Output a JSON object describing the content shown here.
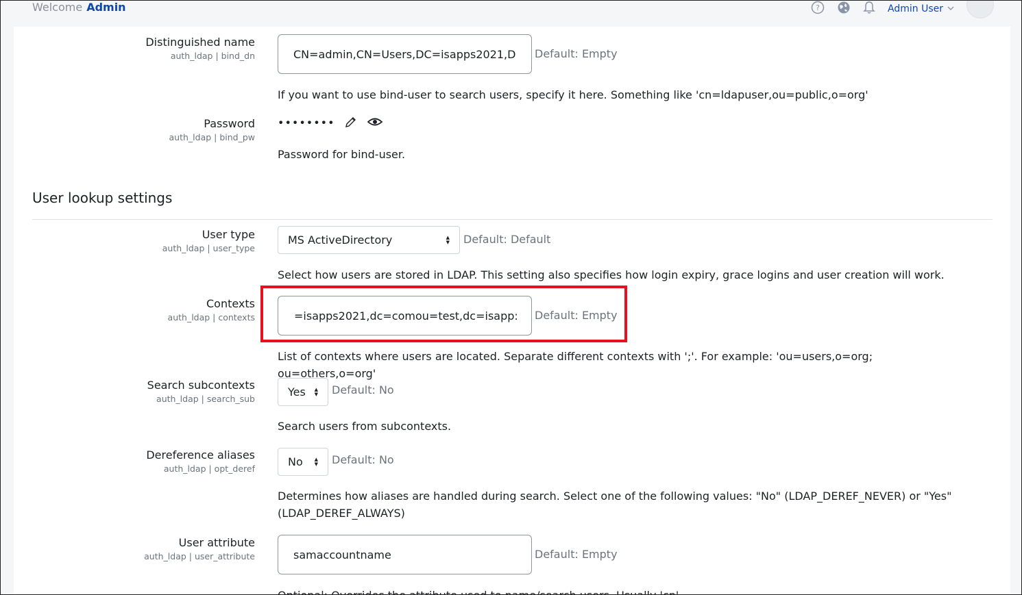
{
  "header": {
    "welcome_text": "Welcome",
    "welcome_name": "Admin",
    "user_menu_label": "Admin User"
  },
  "settings": {
    "bind_dn": {
      "label": "Distinguished name",
      "key": "auth_ldap | bind_dn",
      "value": "CN=admin,CN=Users,DC=isapps2021,D",
      "default": "Default: Empty",
      "description": "If you want to use bind-user to search users, specify it here. Something like 'cn=ldapuser,ou=public,o=org'"
    },
    "bind_pw": {
      "label": "Password",
      "key": "auth_ldap | bind_pw",
      "value": "••••••••",
      "description": "Password for bind-user."
    },
    "section_title": "User lookup settings",
    "user_type": {
      "label": "User type",
      "key": "auth_ldap | user_type",
      "value": "MS ActiveDirectory",
      "default": "Default: Default",
      "description": "Select how users are stored in LDAP. This setting also specifies how login expiry, grace logins and user creation will work."
    },
    "contexts": {
      "label": "Contexts",
      "key": "auth_ldap | contexts",
      "value_before_caret": "=isapps2021,dc=com",
      "value_after_caret": "ou=test,dc=isapp:",
      "default": "Default: Empty",
      "description": "List of contexts where users are located. Separate different contexts with ';'. For example: 'ou=users,o=org; ou=others,o=org'"
    },
    "search_sub": {
      "label": "Search subcontexts",
      "key": "auth_ldap | search_sub",
      "value": "Yes",
      "default": "Default: No",
      "description": "Search users from subcontexts."
    },
    "opt_deref": {
      "label": "Dereference aliases",
      "key": "auth_ldap | opt_deref",
      "value": "No",
      "default": "Default: No",
      "description": "Determines how aliases are handled during search. Select one of the following values: \"No\" (LDAP_DEREF_NEVER) or \"Yes\" (LDAP_DEREF_ALWAYS)"
    },
    "user_attribute": {
      "label": "User attribute",
      "key": "auth_ldap | user_attribute",
      "value": "samaccountname",
      "default": "Default: Empty",
      "description": "Optional: Overrides the attribute used to name/search users. Usually 'cn'."
    }
  },
  "colors": {
    "accent": "#0f47ad",
    "highlight": "#e8101d",
    "caret": "#1f6fe0"
  }
}
